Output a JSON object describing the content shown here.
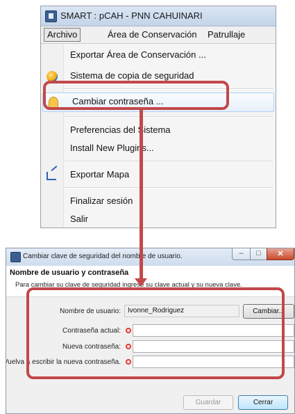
{
  "menu_window": {
    "title": "SMART : pCAH - PNN CAHUINARI",
    "menubar": [
      "Archivo",
      "Área de Conservación",
      "Patrullaje"
    ],
    "items": [
      {
        "label": "Exportar Área de Conservación ...",
        "icon": "none"
      },
      {
        "label": "Sistema de copia de seguridad",
        "icon": "backup-icon"
      },
      {
        "label": "Cambiar contraseña ...",
        "icon": "key-icon"
      },
      {
        "label": "Preferencias del Sistema",
        "icon": "none"
      },
      {
        "label": "Install New Plugins...",
        "icon": "none"
      },
      {
        "label": "Exportar Mapa",
        "icon": "export-map-icon"
      },
      {
        "label": "Finalizar sesión",
        "icon": "none"
      },
      {
        "label": "Salir",
        "icon": "none"
      }
    ]
  },
  "dialog": {
    "title": "Cambiar clave de seguridad del nombre de usuario.",
    "heading": "Nombre de usuario y contraseña",
    "description": "Para cambiar su clave de seguridad ingrese su clave actual y su nueva clave.",
    "username_label": "Nombre de usuario:",
    "username_value": "Ivonne_Rodriguez",
    "change_button": "Cambiar...",
    "current_password_label": "Contraseña actual:",
    "new_password_label": "Nueva contraseña:",
    "repeat_password_label": "Vuelva a escribir la nueva contraseña.",
    "save_button": "Guardar",
    "close_button": "Cerrar",
    "window_buttons": {
      "minimize": "–",
      "maximize": "□",
      "close": "✕"
    }
  },
  "colors": {
    "annotation": "#c2484a",
    "highlight_border": "#aecff7"
  }
}
